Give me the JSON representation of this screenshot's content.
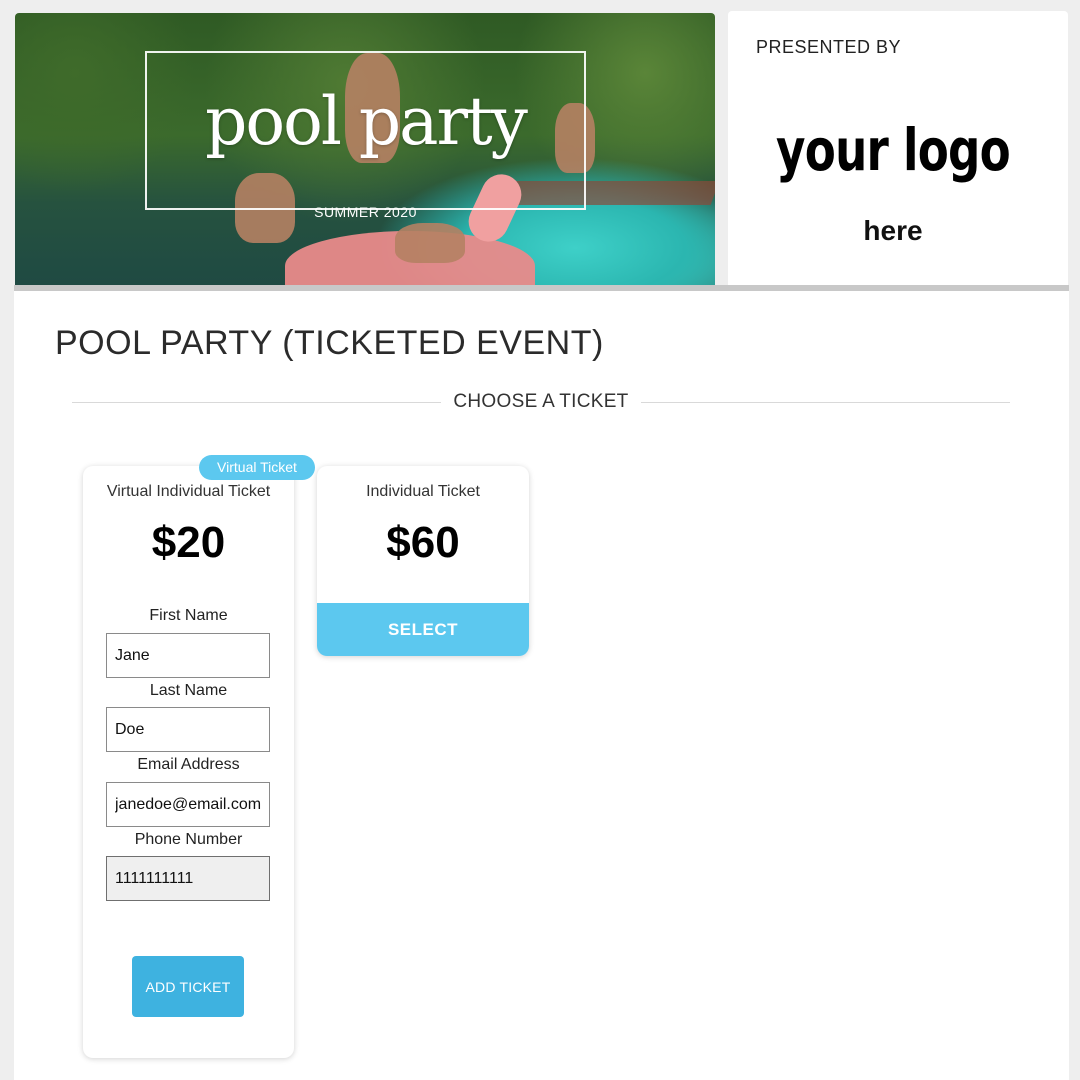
{
  "banner": {
    "title": "pool party",
    "subtitle": "SUMMER 2020"
  },
  "presenter": {
    "label": "PRESENTED BY",
    "logo_main": "your logo",
    "logo_sub": "here"
  },
  "event": {
    "title": "POOL PARTY (TICKETED EVENT)",
    "section_heading": "CHOOSE A TICKET"
  },
  "tickets": [
    {
      "badge": "Virtual Ticket",
      "name": "Virtual Individual Ticket",
      "price": "$20",
      "form": {
        "first_name_label": "First Name",
        "first_name_value": "Jane",
        "last_name_label": "Last Name",
        "last_name_value": "Doe",
        "email_label": "Email Address",
        "email_value": "janedoe@email.com",
        "phone_label": "Phone Number",
        "phone_value": "1111111111"
      },
      "button_label": "ADD TICKET"
    },
    {
      "name": "Individual Ticket",
      "price": "$60",
      "button_label": "SELECT"
    }
  ],
  "colors": {
    "accent": "#5cc8ef",
    "button_primary": "#3eb2e0"
  }
}
